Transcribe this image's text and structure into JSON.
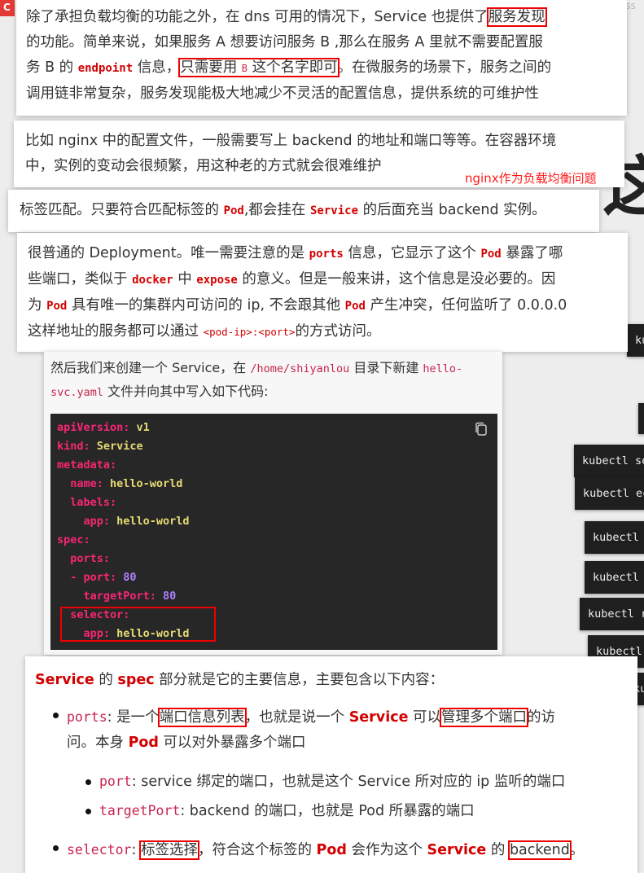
{
  "top": {
    "tab_fragment": "C",
    "right_fragment": "ass"
  },
  "background_glyph": "这",
  "card1": {
    "l1a": "除了承担负载均衡的功能之外，在 dns 可用的情况下，Service 也提供了",
    "l1b": "服务发现",
    "l2a": "的功能。简单来说，如果服务 A 想要访问服务 B ,那么在服务 A 里就不需要配置服",
    "l3a": "务 B 的 ",
    "l3b": "endpoint",
    "l3c": " 信息，",
    "l3d": "只需要用 ",
    "l3e": "B",
    "l3f": " 这个名字即可",
    "l3g": "。在微服务的场景下，服务之间的",
    "l4": "调用链非常复杂，服务发现能极大地减少不灵活的配置信息，提供系统的可维护性"
  },
  "card2": {
    "l1": "比如 nginx 中的配置文件，一般需要写上 backend 的地址和端口等等。在容器环境",
    "l2": "中，实例的变动会很频繁，用这种老的方式就会很难维护",
    "note": "nginx作为负载均衡问题"
  },
  "card3": {
    "a": "标签匹配。只要符合匹配标签的 ",
    "b": "Pod",
    "c": ",都会挂在 ",
    "d": "Service",
    "e": " 的后面充当 backend 实例。"
  },
  "card4": {
    "l1a": "很普通的 Deployment。唯一需要注意的是 ",
    "l1b": "ports",
    "l1c": " 信息，它显示了这个 ",
    "l1d": "Pod",
    "l1e": " 暴露了哪",
    "l2a": "些端口，类似于 ",
    "l2b": "docker",
    "l2c": " 中 ",
    "l2d": "expose",
    "l2e": " 的意义。但是一般来讲，这个信息是没必要的。因",
    "l3a": "为 ",
    "l3b": "Pod",
    "l3c": " 具有唯一的集群内可访问的 ip, 不会跟其他 ",
    "l3d": "Pod",
    "l3e": " 产生冲突，任何监听了 0.0.0.0",
    "l4a": "这样地址的服务都可以通过 ",
    "l4b": "<pod-ip>:<port>",
    "l4c": "的方式访问。"
  },
  "card5": {
    "intro_a": "然后我们来创建一个 Service，在 ",
    "intro_path": "/home/shiyanlou",
    "intro_b": " 目录下新建 ",
    "intro_file1": "hello-",
    "intro_file2": "svc.yaml",
    "intro_c": " 文件并向其中写入如下代码:",
    "code": {
      "l1k": "apiVersion:",
      "l1v": " v1",
      "l2k": "kind:",
      "l2v": " Service",
      "l3k": "metadata:",
      "l4k": "  name:",
      "l4v": " hello-world",
      "l5k": "  labels:",
      "l6k": "    app:",
      "l6v": " hello-world",
      "l7k": "spec:",
      "l8k": "  ports:",
      "l9d": "  - ",
      "l9k": "port:",
      "l9v": " 80",
      "l10k": "    targetPort:",
      "l10v": " 80",
      "l11k": "  selector:",
      "l12k": "    app:",
      "l12v": " hello-world"
    }
  },
  "card6": {
    "h_a": "Service",
    "h_b": " 的 ",
    "h_c": "spec",
    "h_d": " 部分就是它的主要信息，主要包含以下内容：",
    "b1_code": "ports",
    "b1_a": ": 是一个",
    "b1_box1": "端口信息列表",
    "b1_b": "，也就是说一个 ",
    "b1_svc": "Service",
    "b1_c": " 可以",
    "b1_box2": "管理多个端口",
    "b1_d": "的访",
    "b1_l2a": "问。本身 ",
    "b1_pod": "Pod",
    "b1_l2b": " 可以对外暴露多个端口",
    "s1_code": "port",
    "s1_text": ": service 绑定的端口，也就是这个 Service 所对应的 ip 监听的端口",
    "s2_code": "targetPort",
    "s2_text": ": backend 的端口，也就是 Pod 所暴露的端口",
    "b2_code": "selector",
    "b2_a": ": ",
    "b2_box": "标签选择",
    "b2_b": "，符合这个标签的 ",
    "b2_pod": "Pod",
    "b2_c": " 会作为这个 ",
    "b2_svc": "Service",
    "b2_d": " 的 ",
    "b2_box2": "backend",
    "b2_e": "。"
  },
  "kubectl": [
    "ku",
    "kubectl se",
    "kubectl ec",
    "kubectl",
    "kubectl",
    "kubectl r",
    "kubectl",
    "ku"
  ]
}
